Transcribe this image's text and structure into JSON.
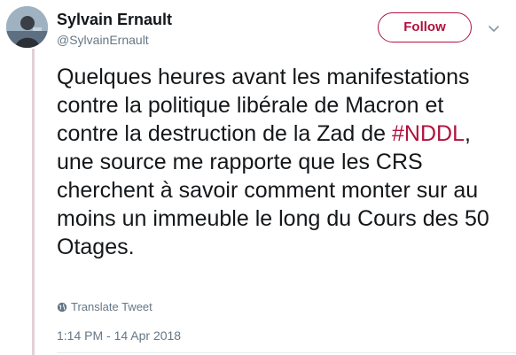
{
  "author": {
    "name": "Sylvain Ernault",
    "handle": "@SylvainErnault"
  },
  "follow_button": {
    "label": "Follow"
  },
  "tweet": {
    "text_before_hashtag": "Quelques heures avant les manifestations contre la politique libérale de Macron et contre la destruction de la Zad de ",
    "hashtag": "#NDDL",
    "text_after_hashtag": ", une source me rapporte que les CRS cherchent à savoir comment monter sur au moins un immeuble le long du Cours des 50 Otages."
  },
  "translate": {
    "label": "Translate Tweet"
  },
  "timestamp": "1:14 PM - 14 Apr 2018",
  "icons": {
    "avatar": "avatar-photo",
    "more": "chevron-down-icon",
    "translate": "globe-icon"
  },
  "colors": {
    "accent": "#b0123e",
    "text": "#14171a",
    "secondary": "#657786",
    "thread_line": "#e1d1d6"
  }
}
